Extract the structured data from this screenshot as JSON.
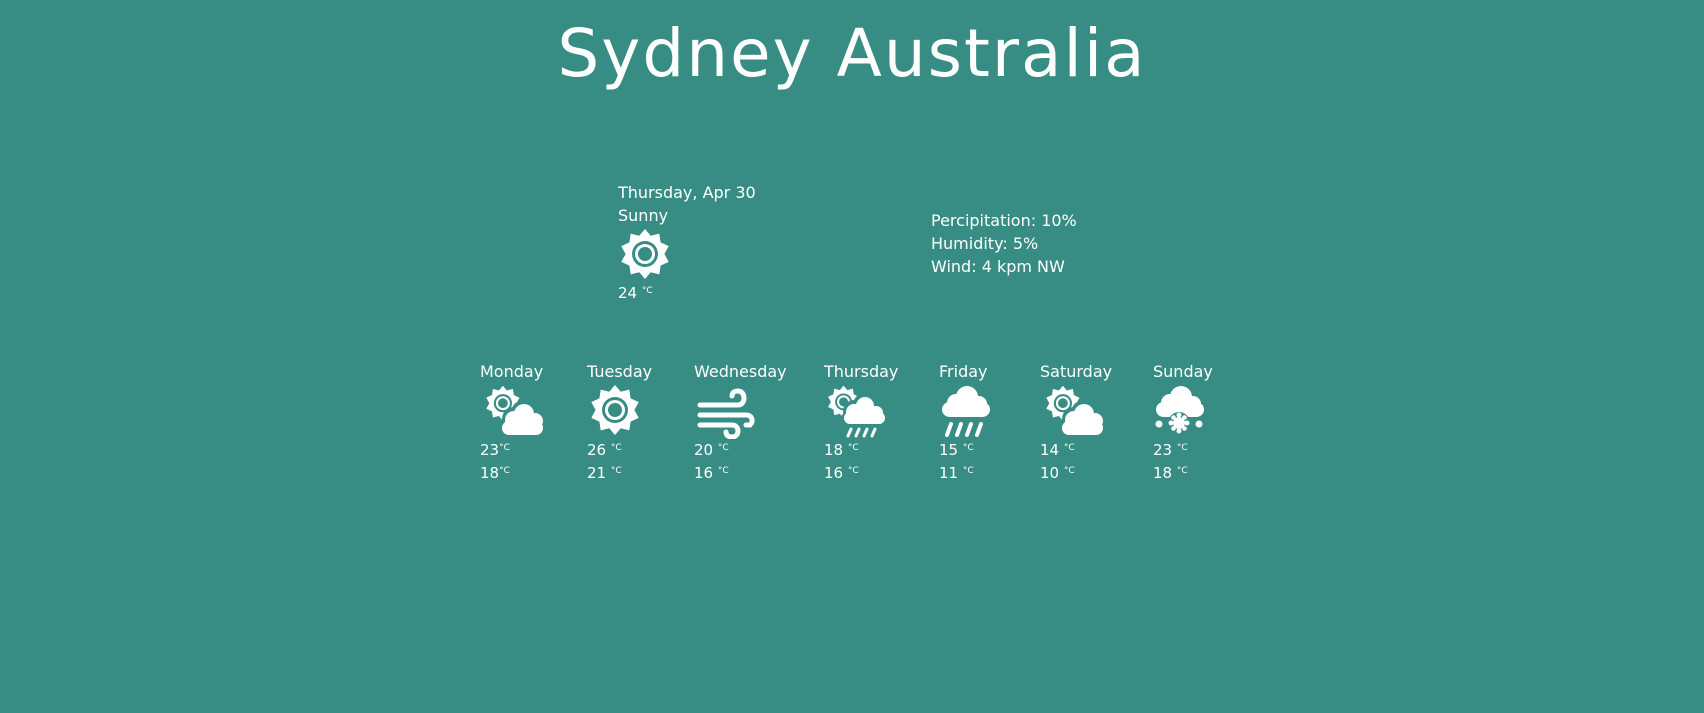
{
  "city_title": "Sydney Australia",
  "colors": {
    "background": "#378d84",
    "text": "#ffffff"
  },
  "current": {
    "date": "Thursday, Apr 30",
    "condition": "Sunny",
    "icon": "sun-icon",
    "temp": "24",
    "unit": "°C"
  },
  "details": {
    "precipitation": "Percipitation: 10%",
    "humidity": "Humidity: 5%",
    "wind": "Wind: 4 kpm NW"
  },
  "forecast": [
    {
      "day": "Monday",
      "icon": "partly-cloudy-icon",
      "high": "23",
      "low": "18",
      "unit": "°C"
    },
    {
      "day": "Tuesday",
      "icon": "sun-icon",
      "high": "26",
      "low": "21",
      "unit": "°C"
    },
    {
      "day": "Wednesday",
      "icon": "wind-icon",
      "high": "20",
      "low": "16",
      "unit": "°C"
    },
    {
      "day": "Thursday",
      "icon": "sun-cloud-rain-icon",
      "high": "18",
      "low": "16",
      "unit": "°C"
    },
    {
      "day": "Friday",
      "icon": "rain-icon",
      "high": "15",
      "low": "11",
      "unit": "°C"
    },
    {
      "day": "Saturday",
      "icon": "partly-cloudy-icon",
      "high": "14",
      "low": "10",
      "unit": "°C"
    },
    {
      "day": "Sunday",
      "icon": "snow-icon",
      "high": "23",
      "low": "18",
      "unit": "°C"
    }
  ]
}
